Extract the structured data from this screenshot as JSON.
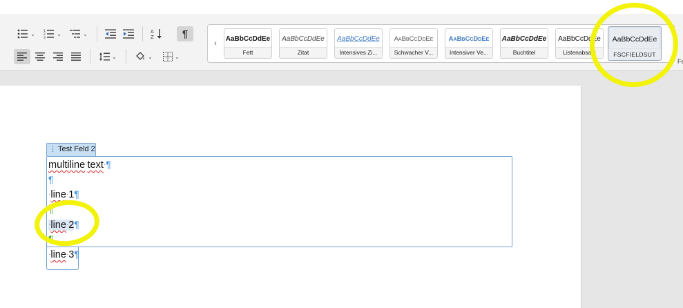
{
  "ribbon": {
    "top_strip_text": "",
    "tools_row1": [
      {
        "name": "bullets-button",
        "icon": "bullet-list-icon",
        "caret": true
      },
      {
        "name": "numbering-button",
        "icon": "numbered-list-icon",
        "caret": true
      },
      {
        "name": "multilevel-list-button",
        "icon": "multilevel-list-icon",
        "caret": true
      },
      {
        "name": "decrease-indent-button",
        "icon": "decrease-indent-icon"
      },
      {
        "name": "increase-indent-button",
        "icon": "increase-indent-icon"
      },
      {
        "name": "sort-button",
        "icon": "sort-icon"
      },
      {
        "name": "show-formatting-button",
        "icon": "pilcrow-icon",
        "pressed": true
      }
    ],
    "tools_row2": [
      {
        "name": "align-left-button",
        "icon": "align-left-icon",
        "pressed": true
      },
      {
        "name": "align-center-button",
        "icon": "align-center-icon"
      },
      {
        "name": "align-right-button",
        "icon": "align-right-icon"
      },
      {
        "name": "justify-button",
        "icon": "justify-icon"
      },
      {
        "name": "line-spacing-button",
        "icon": "line-spacing-icon",
        "caret": true
      },
      {
        "name": "shading-button",
        "icon": "paint-bucket-icon",
        "caret": true
      },
      {
        "name": "borders-button",
        "icon": "borders-icon",
        "caret": true
      }
    ],
    "pilcrow_glyph": "¶",
    "caret_glyph": "⌄",
    "gallery_prev_glyph": "‹",
    "right_edge_letter": "Fe",
    "styles": [
      {
        "sample": "AaBbCcDdEe",
        "caption": "Fett"
      },
      {
        "sample": "AaBbCcDdEe",
        "caption": "Zitat"
      },
      {
        "sample": "AaBbCcDdEe",
        "caption": "Intensives Zi..."
      },
      {
        "sample": "AaBbCcDdEe",
        "caption": "Schwacher V..."
      },
      {
        "sample": "AaBbCcDdEe",
        "caption": "Intensiver Ve..."
      },
      {
        "sample": "AaBbCcDdEe",
        "caption": "Buchtitel"
      },
      {
        "sample": "AaBbCcDdEe",
        "caption": "Listenabsatz"
      },
      {
        "sample": "AaBbCcDdEe",
        "caption": "FSCFIELDSUT"
      }
    ]
  },
  "document": {
    "field_title": "Test Feld 2",
    "field_handle": "⋮",
    "line_multiline_a": "multiline",
    "line_multiline_b": "text",
    "line1_word": "line",
    "line1_num": "1",
    "line2_word": "line",
    "line2_num": "2",
    "line3_word": "line",
    "line3_num": "3",
    "space_dot": "·",
    "pilcrow": "¶"
  },
  "colors": {
    "marker": "#f2f20a",
    "field_border": "#6f9fd0",
    "pilcrow_blue": "#3a8ee6",
    "pilcrow_green": "#4aa02c"
  }
}
